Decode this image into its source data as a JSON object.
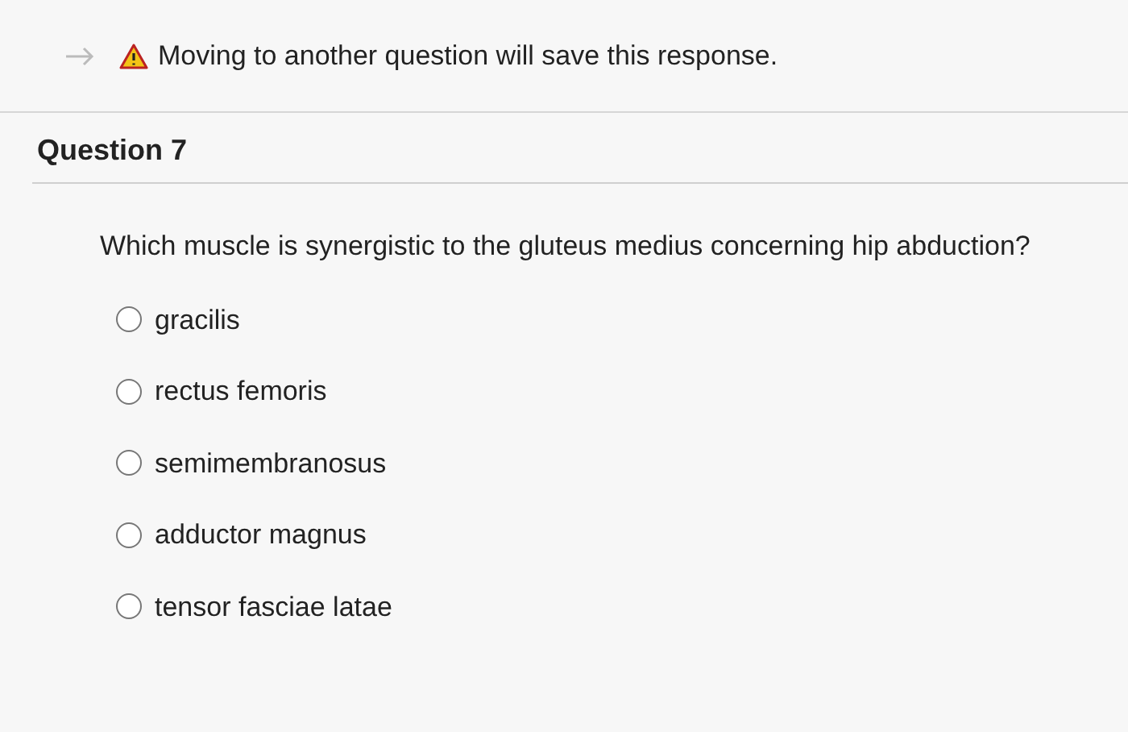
{
  "notice": "Moving to another question will save this response.",
  "question": {
    "title": "Question 7",
    "text": "Which muscle is synergistic to the gluteus medius concerning hip abduction?",
    "options": [
      {
        "label": "gracilis",
        "selected": false
      },
      {
        "label": "rectus femoris",
        "selected": false
      },
      {
        "label": "semimembranosus",
        "selected": false
      },
      {
        "label": "adductor magnus",
        "selected": false
      },
      {
        "label": "tensor fasciae latae",
        "selected": false
      }
    ]
  }
}
